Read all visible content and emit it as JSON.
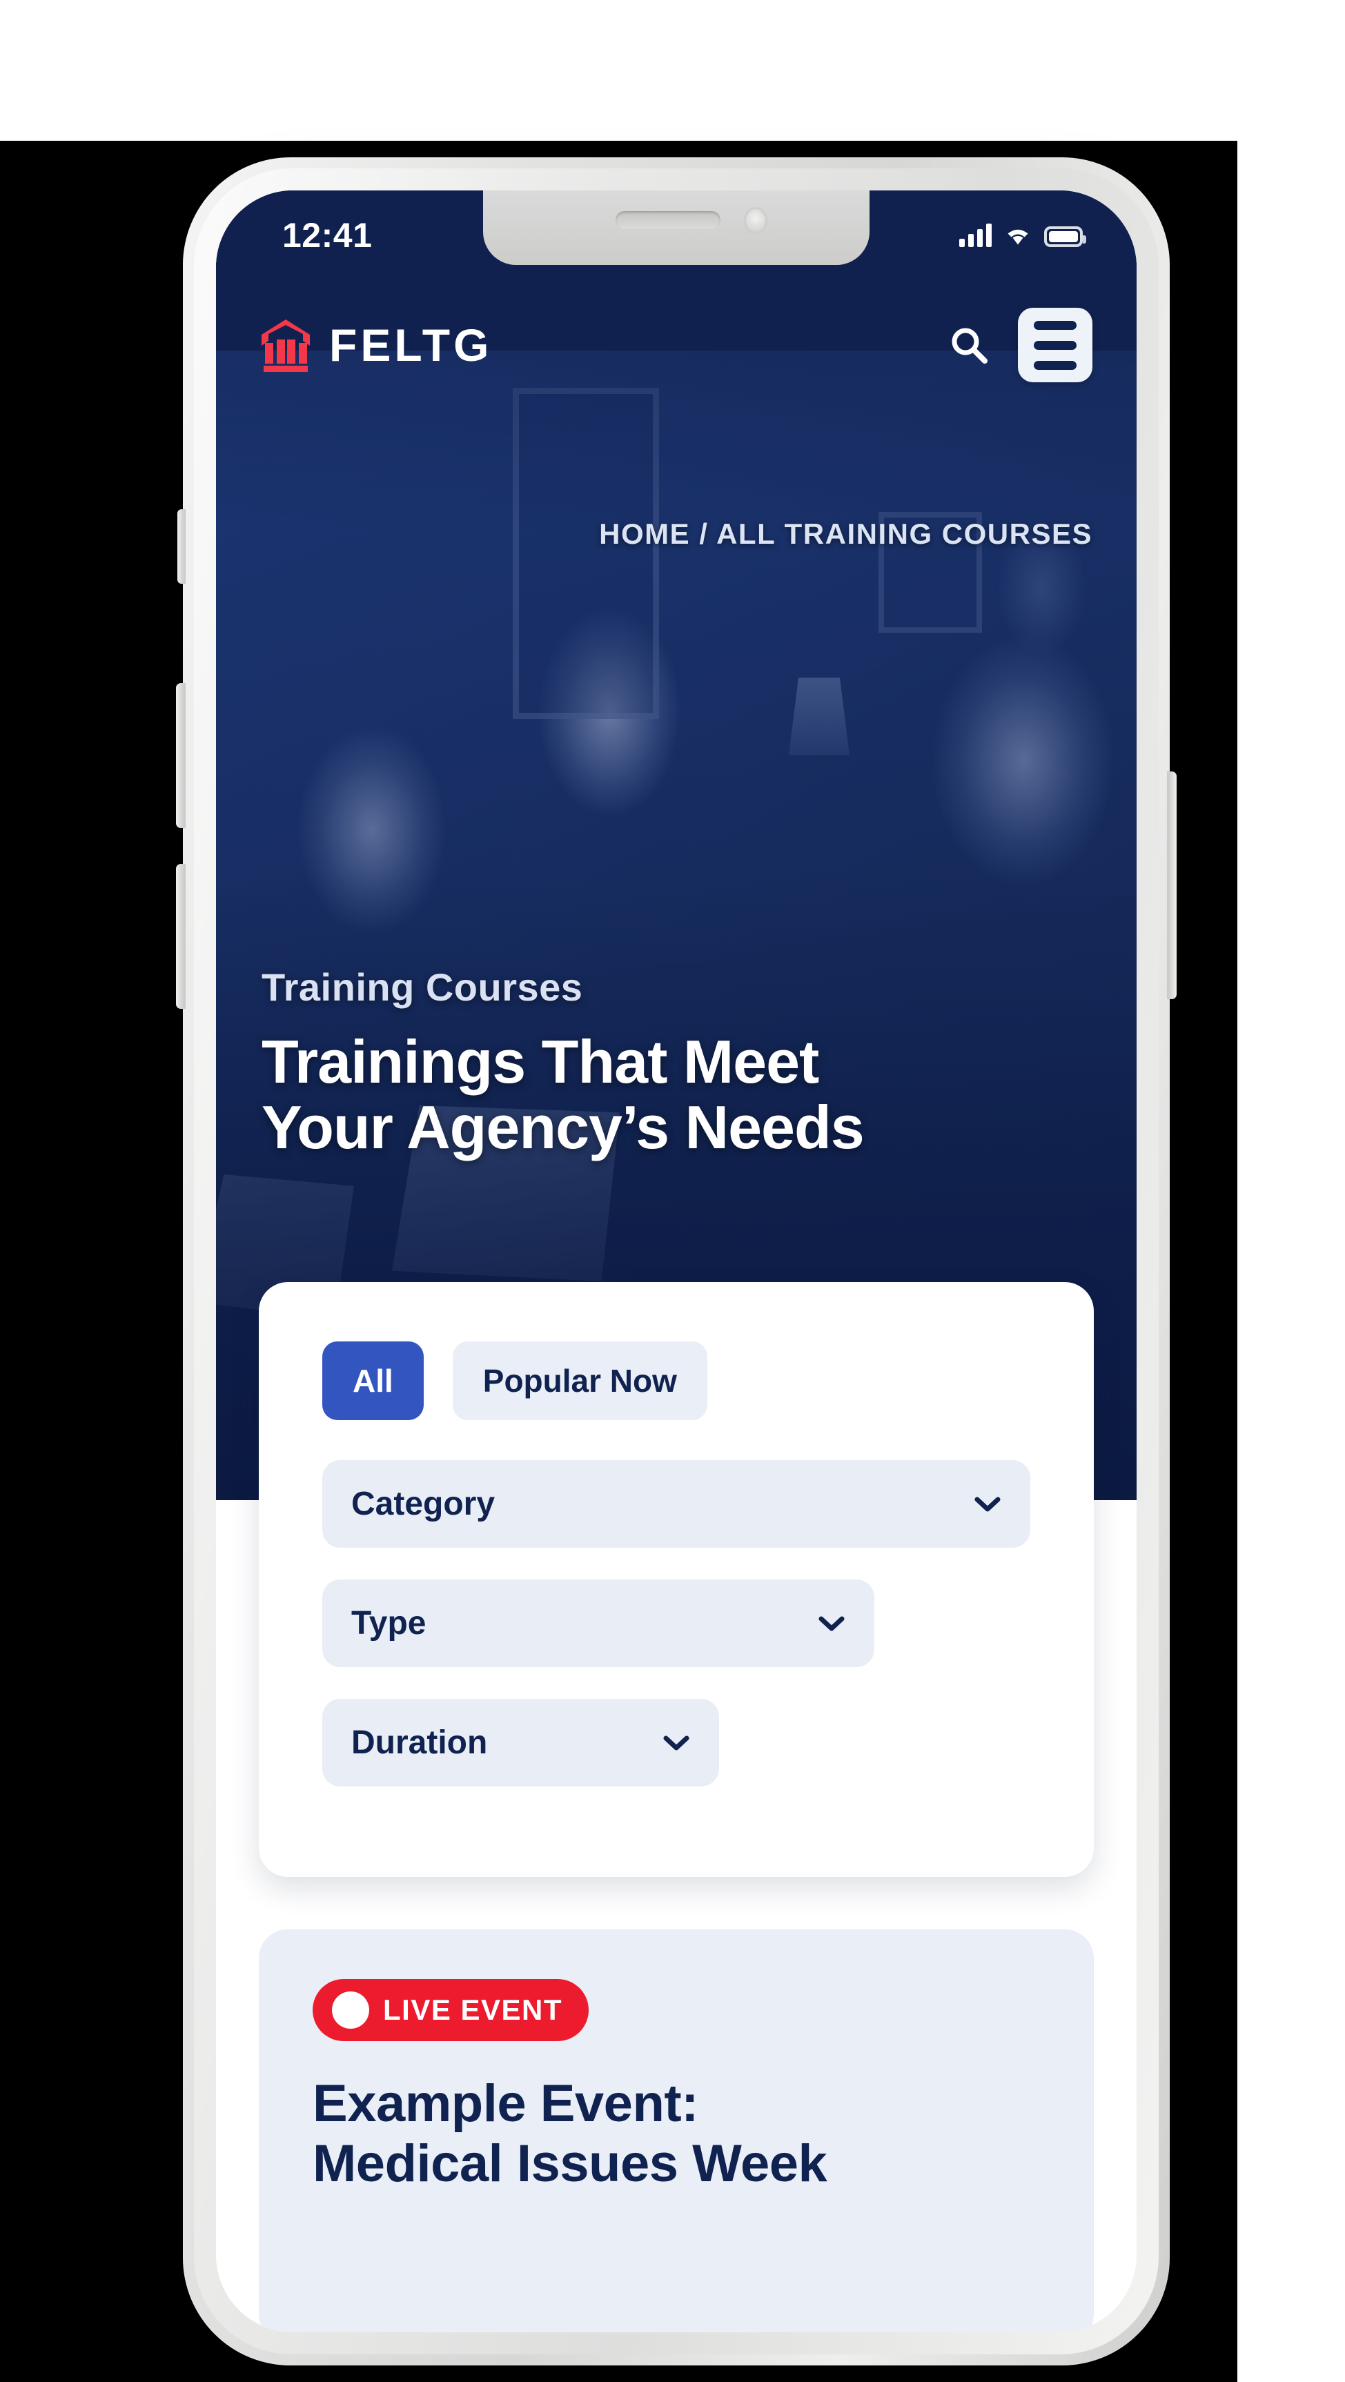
{
  "status_bar": {
    "time": "12:41",
    "signal_icon": "cellular-signal-icon",
    "wifi_icon": "wifi-icon",
    "battery_icon": "battery-full-icon"
  },
  "header": {
    "logo_icon": "feltg-building-logo-icon",
    "brand": "FELTG",
    "search_icon": "search-icon",
    "menu_icon": "hamburger-menu-icon"
  },
  "breadcrumb": {
    "text": "HOME / ALL TRAINING COURSES",
    "home": "HOME",
    "separator": "/",
    "current": "ALL TRAINING COURSES"
  },
  "hero": {
    "eyebrow": "Training Courses",
    "title_line1": "Trainings That Meet",
    "title_line2": "Your Agency’s Needs"
  },
  "filters": {
    "tabs": [
      {
        "label": "All",
        "active": true
      },
      {
        "label": "Popular Now",
        "active": false
      }
    ],
    "dropdowns": [
      {
        "label": "Category",
        "chevron_icon": "chevron-down-icon"
      },
      {
        "label": "Type",
        "chevron_icon": "chevron-down-icon"
      },
      {
        "label": "Duration",
        "chevron_icon": "chevron-down-icon"
      }
    ]
  },
  "event_card": {
    "badge_label": "LIVE EVENT",
    "badge_dot_icon": "live-dot-icon",
    "title_line1": "Example Event:",
    "title_line2": "Medical Issues Week"
  },
  "colors": {
    "navy": "#10224f",
    "hero_bg": "#0e1f4d",
    "accent_blue": "#3355c0",
    "brand_red": "#ed1b2e",
    "chip_bg": "#e9edf6",
    "card_bg": "#e9eef7",
    "page_black": "#000000"
  }
}
